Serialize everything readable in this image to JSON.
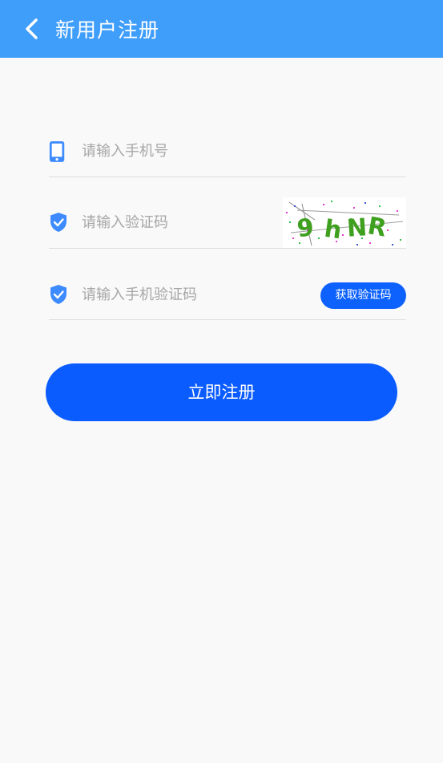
{
  "header": {
    "title": "新用户注册",
    "background": "#409efb"
  },
  "form": {
    "phone": {
      "placeholder": "请输入手机号",
      "icon": "phone-icon"
    },
    "captcha": {
      "placeholder": "请输入验证码",
      "icon": "shield-check-icon",
      "image_text": "9hNR"
    },
    "sms_code": {
      "placeholder": "请输入手机验证码",
      "icon": "shield-check-icon",
      "button_label": "获取验证码"
    }
  },
  "submit": {
    "label": "立即注册",
    "color": "#0b5cff"
  }
}
